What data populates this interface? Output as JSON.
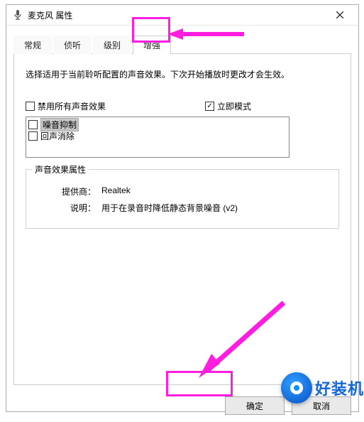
{
  "window": {
    "title": "麦克风 属性"
  },
  "tabs": {
    "items": [
      "常规",
      "侦听",
      "级别",
      "增强"
    ],
    "active_index": 3
  },
  "page": {
    "description": "选择适用于当前聆听配置的声音效果。下次开始播放时更改才会生效。",
    "disable_all_label": "禁用所有声音效果",
    "instant_mode_label": "立即模式",
    "effects": {
      "items": [
        {
          "label": "噪音抑制",
          "selected": true
        },
        {
          "label": "回声消除",
          "selected": false
        }
      ]
    },
    "group": {
      "legend": "声音效果属性",
      "provider_key": "提供商：",
      "provider_val": "Realtek",
      "desc_key": "说明：",
      "desc_val": "用于在录音时降低静态背景噪音 (v2)"
    }
  },
  "buttons": {
    "ok": "确定",
    "cancel": "取消"
  },
  "watermark": "好装机"
}
